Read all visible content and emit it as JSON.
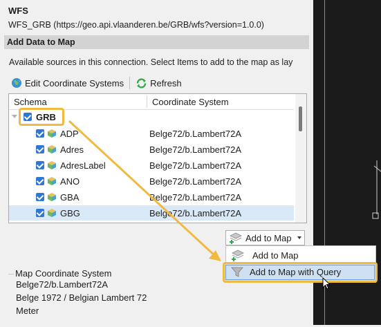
{
  "header": {
    "title": "WFS",
    "url": "WFS_GRB (https://geo.api.vlaanderen.be/GRB/wfs?version=1.0.0)"
  },
  "section": {
    "title": "Add Data to Map",
    "description": "Available sources in this connection.  Select Items to add to the map as lay"
  },
  "toolbar": {
    "edit_crs_label": "Edit Coordinate Systems",
    "refresh_label": "Refresh"
  },
  "tree": {
    "columns": [
      "Schema",
      "Coordinate System"
    ],
    "root": {
      "label": "GRB",
      "checked": true
    },
    "rows": [
      {
        "name": "ADP",
        "crs": "Belge72/b.Lambert72A",
        "checked": true
      },
      {
        "name": "Adres",
        "crs": "Belge72/b.Lambert72A",
        "checked": true
      },
      {
        "name": "AdresLabel",
        "crs": "Belge72/b.Lambert72A",
        "checked": true
      },
      {
        "name": "ANO",
        "crs": "Belge72/b.Lambert72A",
        "checked": true
      },
      {
        "name": "GBA",
        "crs": "Belge72/b.Lambert72A",
        "checked": true
      },
      {
        "name": "GBG",
        "crs": "Belge72/b.Lambert72A",
        "checked": true
      }
    ]
  },
  "add_button": {
    "label": "Add to Map",
    "menu": [
      "Add to Map",
      "Add to Map with Query"
    ]
  },
  "map_crs": {
    "title": "Map Coordinate System",
    "lines": [
      "Belge72/b.Lambert72A",
      "Belge 1972 / Belgian Lambert 72",
      "Meter"
    ]
  },
  "colors": {
    "highlight": "#f0b940",
    "checkbox": "#2f77d1",
    "selected_row": "#d9e9f7"
  }
}
